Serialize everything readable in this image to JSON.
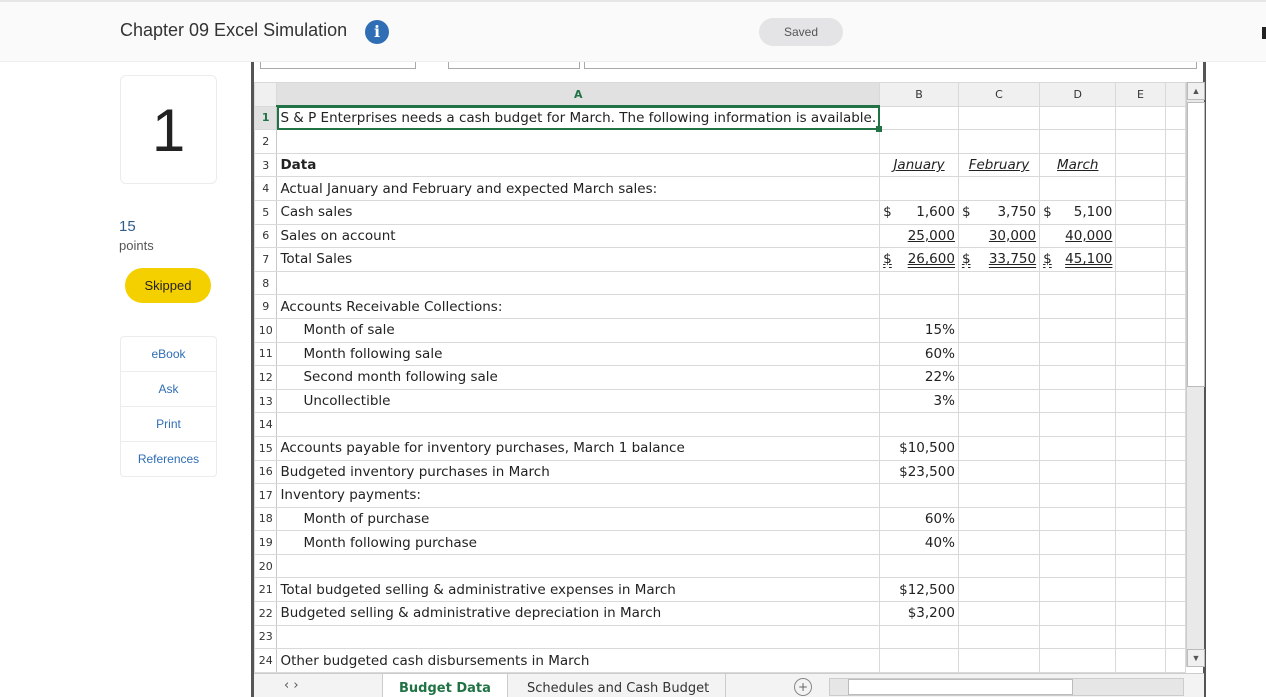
{
  "header": {
    "title": "Chapter 09 Excel Simulation",
    "info_icon": "info-icon",
    "status": "Saved"
  },
  "sidebar": {
    "question_number": "1",
    "points_value": "15",
    "points_label": "points",
    "status_badge": "Skipped",
    "tools": [
      {
        "label": "eBook"
      },
      {
        "label": "Ask"
      },
      {
        "label": "Print"
      },
      {
        "label": "References"
      }
    ]
  },
  "sheet": {
    "columns": [
      "A",
      "B",
      "C",
      "D",
      "E"
    ],
    "selected_cell": "A1",
    "rows": [
      {
        "n": "1",
        "a": "S & P Enterprises needs a cash budget for March. The following information is available."
      },
      {
        "n": "2",
        "a": ""
      },
      {
        "n": "3",
        "a": "Data",
        "b": "January",
        "c": "February",
        "d": "March"
      },
      {
        "n": "4",
        "a": "Actual January and February and expected March sales:"
      },
      {
        "n": "5",
        "a": "Cash sales",
        "b": "1,600",
        "c": "3,750",
        "d": "5,100"
      },
      {
        "n": "6",
        "a": "Sales on account",
        "b": "25,000",
        "c": "30,000",
        "d": "40,000"
      },
      {
        "n": "7",
        "a": "Total Sales",
        "b": "26,600",
        "c": "33,750",
        "d": "45,100"
      },
      {
        "n": "8",
        "a": ""
      },
      {
        "n": "9",
        "a": "Accounts Receivable Collections:"
      },
      {
        "n": "10",
        "a": "Month of sale",
        "b": "15%"
      },
      {
        "n": "11",
        "a": "Month following sale",
        "b": "60%"
      },
      {
        "n": "12",
        "a": "Second month following sale",
        "b": "22%"
      },
      {
        "n": "13",
        "a": "Uncollectible",
        "b": "3%"
      },
      {
        "n": "14",
        "a": ""
      },
      {
        "n": "15",
        "a": "Accounts payable for inventory purchases, March 1 balance",
        "b": "$10,500"
      },
      {
        "n": "16",
        "a": "Budgeted inventory purchases in March",
        "b": "$23,500"
      },
      {
        "n": "17",
        "a": "Inventory payments:"
      },
      {
        "n": "18",
        "a": "Month of purchase",
        "b": "60%"
      },
      {
        "n": "19",
        "a": "Month following purchase",
        "b": "40%"
      },
      {
        "n": "20",
        "a": ""
      },
      {
        "n": "21",
        "a": "Total budgeted selling & administrative expenses in March",
        "b": "$12,500"
      },
      {
        "n": "22",
        "a": "Budgeted selling & administrative depreciation in March",
        "b": "$3,200"
      },
      {
        "n": "23",
        "a": ""
      },
      {
        "n": "24",
        "a": "Other budgeted cash disbursements in March"
      }
    ],
    "currency_symbol": "$",
    "tabs": [
      {
        "label": "Budget Data",
        "active": true
      },
      {
        "label": "Schedules and Cash Budget",
        "active": false
      }
    ],
    "tab_nav": "‹   ›",
    "add_sheet": "+"
  },
  "colors": {
    "accent_green": "#217346",
    "info_blue": "#2f6db5",
    "skipped_yellow": "#f5d000"
  }
}
